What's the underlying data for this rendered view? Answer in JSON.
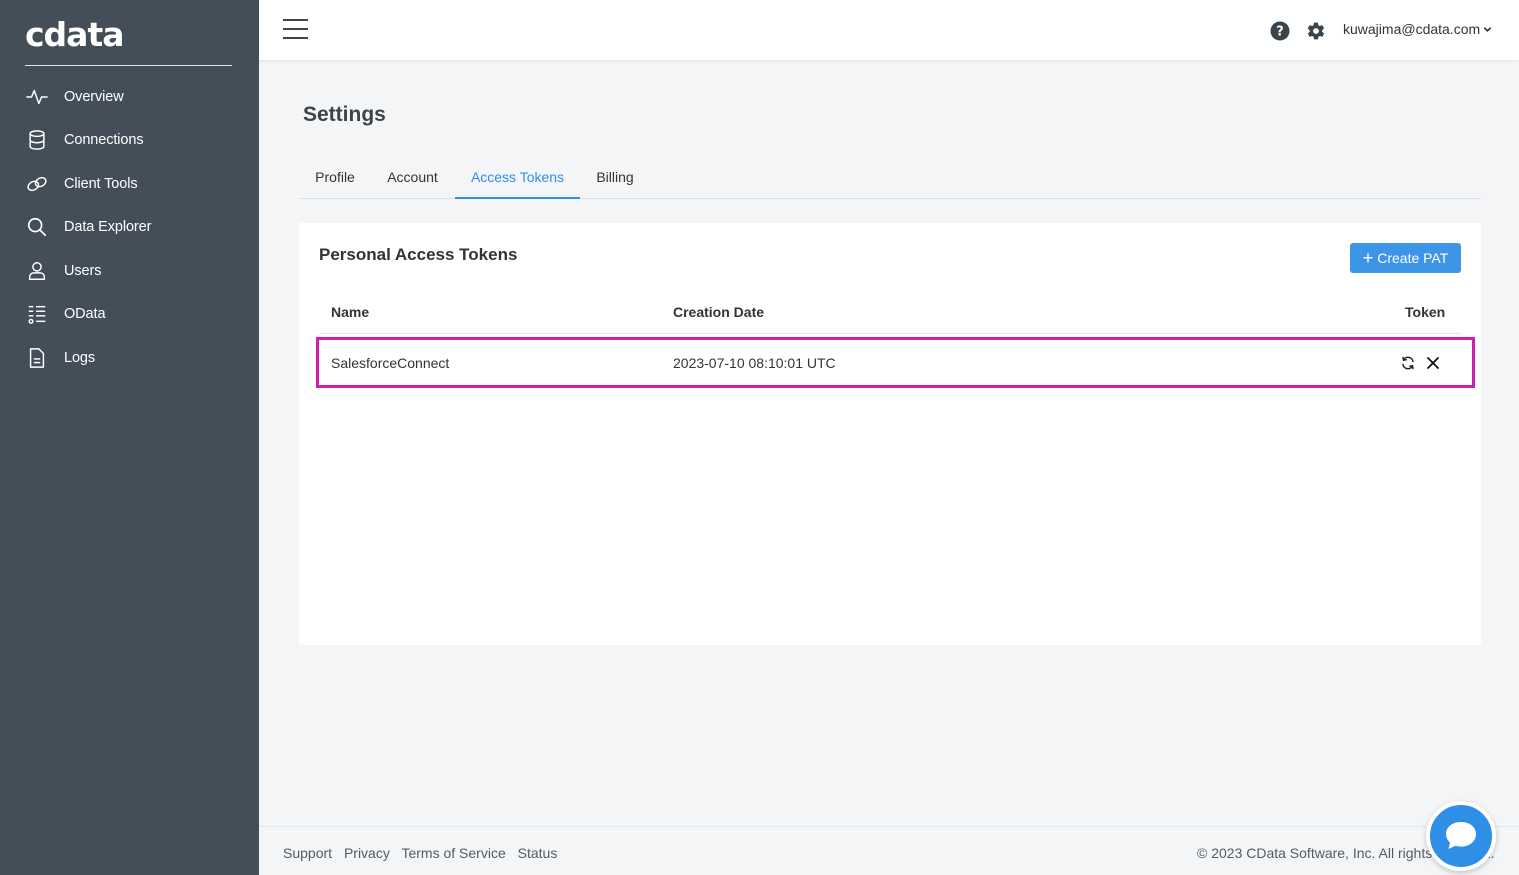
{
  "brand": {
    "logo_text": "cdata"
  },
  "sidebar": {
    "items": [
      {
        "label": "Overview",
        "icon": "pulse-icon"
      },
      {
        "label": "Connections",
        "icon": "database-icon"
      },
      {
        "label": "Client Tools",
        "icon": "link-icon"
      },
      {
        "label": "Data Explorer",
        "icon": "search-icon"
      },
      {
        "label": "Users",
        "icon": "user-icon"
      },
      {
        "label": "OData",
        "icon": "list-icon"
      },
      {
        "label": "Logs",
        "icon": "document-icon"
      }
    ]
  },
  "header": {
    "user_email": "kuwajima@cdata.com",
    "icons": [
      "menu-icon",
      "help-icon",
      "gear-icon",
      "chevron-down-icon"
    ]
  },
  "page": {
    "title": "Settings",
    "tabs": [
      {
        "label": "Profile",
        "active": false
      },
      {
        "label": "Account",
        "active": false
      },
      {
        "label": "Access Tokens",
        "active": true
      },
      {
        "label": "Billing",
        "active": false
      }
    ]
  },
  "tokens_card": {
    "title": "Personal Access Tokens",
    "create_button": "Create PAT",
    "columns": [
      "Name",
      "Creation Date",
      "Token"
    ],
    "rows": [
      {
        "name": "SalesforceConnect",
        "creation_date": "2023-07-10 08:10:01 UTC"
      }
    ]
  },
  "footer": {
    "links": [
      "Support",
      "Privacy",
      "Terms of Service",
      "Status"
    ],
    "copyright": "© 2023 CData Software, Inc. All rights reserved."
  },
  "colors": {
    "sidebar_bg": "#434e59",
    "accent": "#2f8fe6",
    "highlight_border": "#cc1fb3"
  }
}
